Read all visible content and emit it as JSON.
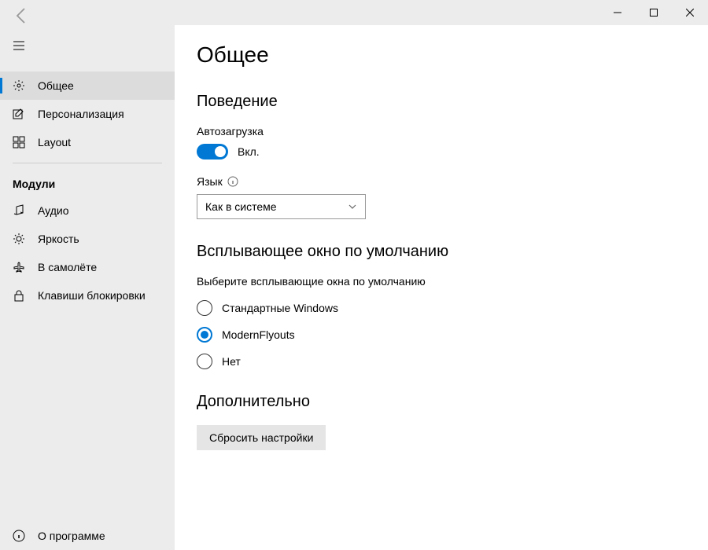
{
  "sidebar": {
    "items": [
      {
        "label": "Общее"
      },
      {
        "label": "Персонализация"
      },
      {
        "label": "Layout"
      }
    ],
    "modules_label": "Модули",
    "modules": [
      {
        "label": "Аудио"
      },
      {
        "label": "Яркость"
      },
      {
        "label": "В самолёте"
      },
      {
        "label": "Клавиши блокировки"
      }
    ],
    "about_label": "О программе"
  },
  "main": {
    "page_title": "Общее",
    "behavior": {
      "title": "Поведение",
      "autostart_label": "Автозагрузка",
      "autostart_state": "Вкл.",
      "language_label": "Язык",
      "language_value": "Как в системе"
    },
    "default_flyout": {
      "title": "Всплывающее окно по умолчанию",
      "desc": "Выберите всплывающие окна по умолчанию",
      "options": [
        {
          "label": "Стандартные Windows"
        },
        {
          "label": "ModernFlyouts"
        },
        {
          "label": "Нет"
        }
      ]
    },
    "advanced": {
      "title": "Дополнительно",
      "reset_label": "Сбросить настройки"
    }
  }
}
